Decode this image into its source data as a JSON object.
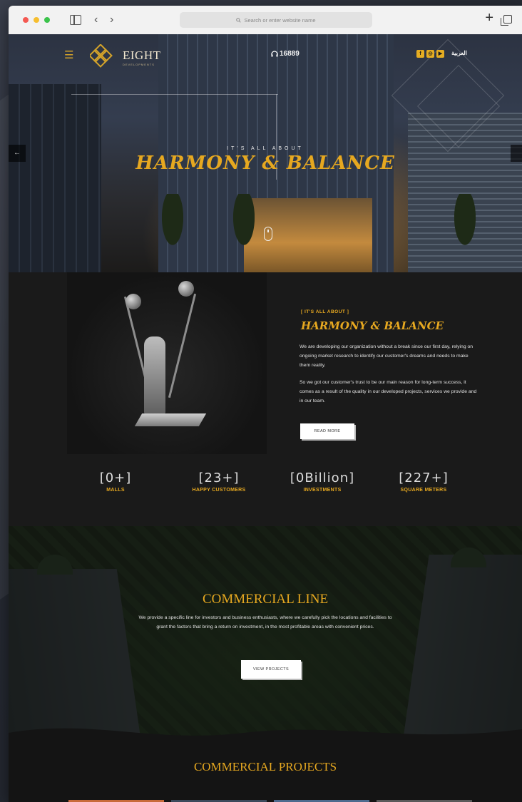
{
  "browser": {
    "address_placeholder": "Search or enter website name",
    "back_glyph": "‹",
    "forward_glyph": "›",
    "plus_glyph": "+"
  },
  "header": {
    "logo_text": "EIGHT",
    "logo_subtext": "DEVELOPMENTS",
    "hotline": "16889",
    "language": "العربية",
    "social_icons": [
      "facebook-icon",
      "instagram-icon",
      "youtube-icon"
    ]
  },
  "hero": {
    "kicker": "IT'S ALL ABOUT",
    "title": "HARMONY & BALANCE",
    "prev_glyph": "←"
  },
  "about": {
    "kicker": "[ IT'S ALL ABOUT ]",
    "title": "HARMONY & BALANCE",
    "paragraph1": "We are developing our organization without a break since our first day, relying on ongoing market research to identify our customer's dreams and needs to make them reality.",
    "paragraph2": "So we got our customer's trust to be our main reason for long-term success, it comes as a result of the quality in our developed projects, services we provide and in our team.",
    "read_more": "READ MORE"
  },
  "stats": [
    {
      "value": "[0+]",
      "label": "MALLS"
    },
    {
      "value": "[23+]",
      "label": "HAPPY CUSTOMERS"
    },
    {
      "value": "[0Billion]",
      "label": "INVESTMENTS"
    },
    {
      "value": "[227+]",
      "label": "SQUARE METERS"
    }
  ],
  "commercial": {
    "title": "COMMERCIAL LINE",
    "text": "We provide a specific line for investors and business enthusiasts, where we carefully pick the locations and facilities to grant the factors that bring a return on investment, in the most profitable areas with convenient prices.",
    "button": "VIEW PROJECTS"
  },
  "projects": {
    "title": "COMMERCIAL PROJECTS"
  },
  "colors": {
    "accent": "#e6a820",
    "background": "#1a1a1a"
  }
}
